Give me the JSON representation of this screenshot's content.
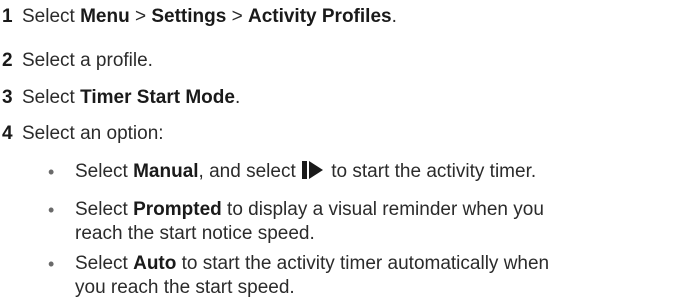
{
  "steps": [
    {
      "number": "1",
      "segments": [
        {
          "text": "Select ",
          "bold": false
        },
        {
          "text": "Menu",
          "bold": true
        },
        {
          "text": " > ",
          "bold": false
        },
        {
          "text": "Settings",
          "bold": true
        },
        {
          "text": " > ",
          "bold": false
        },
        {
          "text": "Activity Profiles",
          "bold": true
        },
        {
          "text": ".",
          "bold": false
        }
      ]
    },
    {
      "number": "2",
      "segments": [
        {
          "text": "Select a profile.",
          "bold": false
        }
      ]
    },
    {
      "number": "3",
      "segments": [
        {
          "text": "Select ",
          "bold": false
        },
        {
          "text": "Timer Start Mode",
          "bold": true
        },
        {
          "text": ".",
          "bold": false
        }
      ]
    },
    {
      "number": "4",
      "segments": [
        {
          "text": "Select an option:",
          "bold": false
        }
      ]
    }
  ],
  "options": [
    {
      "bullet": "•",
      "lines": [
        [
          {
            "text": "Select ",
            "bold": false
          },
          {
            "text": "Manual",
            "bold": true
          },
          {
            "text": ", and select ",
            "bold": false
          },
          {
            "icon": "start-stop-icon"
          },
          {
            "text": " to start the activity timer.",
            "bold": false
          }
        ]
      ]
    },
    {
      "bullet": "•",
      "lines": [
        [
          {
            "text": "Select ",
            "bold": false
          },
          {
            "text": "Prompted",
            "bold": true
          },
          {
            "text": " to display a visual reminder when you",
            "bold": false
          }
        ],
        [
          {
            "text": "reach the start notice speed.",
            "bold": false
          }
        ]
      ]
    },
    {
      "bullet": "•",
      "lines": [
        [
          {
            "text": "Select ",
            "bold": false
          },
          {
            "text": "Auto",
            "bold": true
          },
          {
            "text": " to start the activity timer automatically when",
            "bold": false
          }
        ],
        [
          {
            "text": "you reach the start speed.",
            "bold": false
          }
        ]
      ]
    }
  ],
  "icon_color": "#1a1a1a",
  "text_color": "#2b2b2b"
}
